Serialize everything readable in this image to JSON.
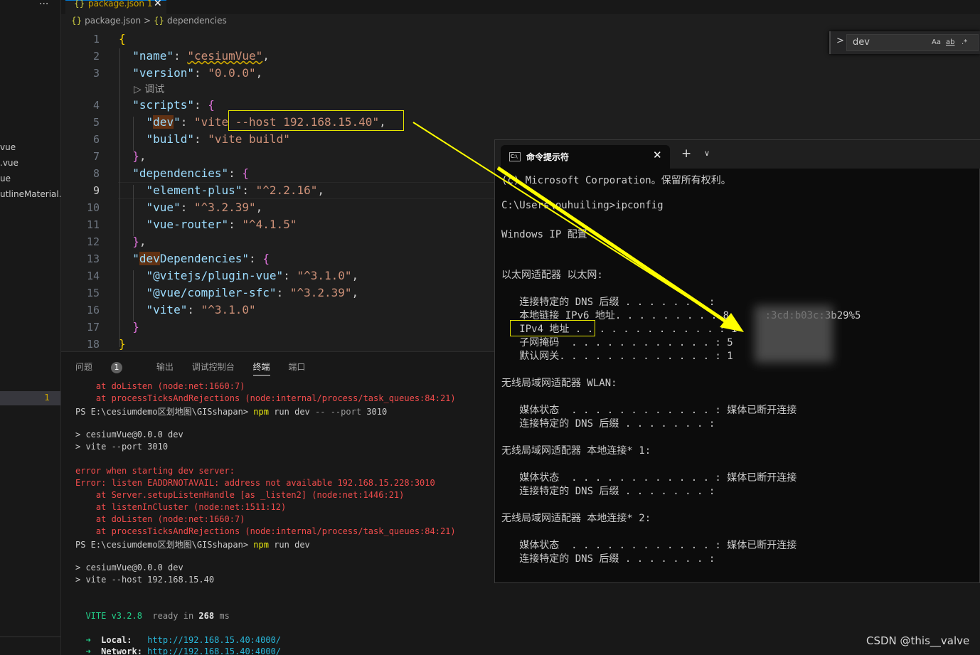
{
  "sidebar": {
    "more": "···",
    "files": [
      "vue",
      ".vue",
      "ue",
      "utlineMaterial..."
    ],
    "active_badge": "1"
  },
  "editor": {
    "tab": {
      "icon": "{}",
      "name": "package.json 1"
    },
    "breadcrumb": {
      "file": "package.json",
      "sep": ">",
      "node_icon": "{}",
      "node": "dependencies"
    },
    "line_numbers": [
      "1",
      "2",
      "3",
      "4",
      "5",
      "6",
      "7",
      "8",
      "9",
      "10",
      "11",
      "12",
      "13",
      "14",
      "15",
      "16",
      "17",
      "18"
    ],
    "codelens": "▷ 调试",
    "lines": {
      "l1": "{",
      "l2": [
        "\"name\"",
        ": ",
        "\"cesiumVue\"",
        ","
      ],
      "l3": [
        "\"version\"",
        ": ",
        "\"0.0.0\"",
        ","
      ],
      "l4": [
        "\"scripts\"",
        ": ",
        "{"
      ],
      "l5": [
        "\"",
        "dev",
        "\"",
        ": ",
        "\"vite --host 192.168.15.40\"",
        ","
      ],
      "l6": [
        "\"build\"",
        ": ",
        "\"vite build\""
      ],
      "l7": [
        "}",
        ","
      ],
      "l8": [
        "\"dependencies\"",
        ": ",
        "{"
      ],
      "l9": [
        "\"element-plus\"",
        ": ",
        "\"^2.2.16\"",
        ","
      ],
      "l10": [
        "\"vue\"",
        ": ",
        "\"^3.2.39\"",
        ","
      ],
      "l11": [
        "\"vue-router\"",
        ": ",
        "\"^4.1.5\""
      ],
      "l12": [
        "}",
        ","
      ],
      "l13": [
        "\"",
        "dev",
        "Dependencies\"",
        ": ",
        "{"
      ],
      "l14": [
        "\"@vitejs/plugin-vue\"",
        ": ",
        "\"^3.1.0\"",
        ","
      ],
      "l15": [
        "\"@vue/compiler-sfc\"",
        ": ",
        "\"^3.2.39\"",
        ","
      ],
      "l16": [
        "\"vite\"",
        ": ",
        "\"^3.1.0\""
      ],
      "l17": "}",
      "l18": "}"
    }
  },
  "find_widget": {
    "chevron": ">",
    "value": "dev",
    "opt_case": "Aa",
    "opt_word": "ab",
    "opt_regex": ".*"
  },
  "panel": {
    "tabs": {
      "problems": "问题",
      "problems_count": "1",
      "output": "输出",
      "debug": "调试控制台",
      "terminal": "终端",
      "ports": "端口"
    },
    "terminal": {
      "t1": "    at doListen (node:net:1660:7)",
      "t2": "    at processTicksAndRejections (node:internal/process/task_queues:84:21)",
      "t3_prompt": "PS E:\\cesiumdemo区划地图\\GISshapan> ",
      "t3_npm": "npm",
      "t3_cmd": " run dev ",
      "t3_args": "-- --port",
      "t3_num": " 3010",
      "t4": "> cesiumVue@0.0.0 dev",
      "t5": "> vite --port 3010",
      "t6": "error when starting dev server:",
      "t7": "Error: listen EADDRNOTAVAIL: address not available 192.168.15.228:3010",
      "t8": "    at Server.setupListenHandle [as _listen2] (node:net:1446:21)",
      "t9": "    at listenInCluster (node:net:1511:12)",
      "t10": "    at doListen (node:net:1660:7)",
      "t11": "    at processTicksAndRejections (node:internal/process/task_queues:84:21)",
      "t12_prompt": "PS E:\\cesiumdemo区划地图\\GISshapan> ",
      "t12_npm": "npm",
      "t12_cmd": " run dev",
      "t13": "> cesiumVue@0.0.0 dev",
      "t14": "> vite --host 192.168.15.40",
      "t15_vite": "VITE v3.2.8",
      "t15_ready": "ready in",
      "t15_ms": "268",
      "t15_unit": "ms",
      "t16_arrow": "➜",
      "t16_label": "Local:",
      "t16_url": "http://192.168.15.40:4000/",
      "t17_arrow": "➜",
      "t17_label": "Network:",
      "t17_url": "http://192.168.15.40:4000/"
    }
  },
  "cmd": {
    "title": "命令提示符",
    "icon_text": "C:\\",
    "close": "✕",
    "new_tab": "+",
    "dropdown": "∨",
    "lines": {
      "c1": "(c) Microsoft Corporation。保留所有权利。",
      "c2": "C:\\Users\\ouhuiling>ipconfig",
      "c3": "Windows IP 配置",
      "c4": "以太网适配器 以太网:",
      "c5": "   连接特定的 DNS 后缀 . . . . . . . :",
      "c6": "   本地链接 IPv6 地址. . . . . . . . : 8      :3cd:b03c:3b29%5",
      "c7": "   IPv4 地址 . . . . . . . . . . . . : 1",
      "c8": "   子网掩码  . . . . . . . . . . . . : 5",
      "c9": "   默认网关. . . . . . . . . . . . . : 1",
      "c10": "无线局域网适配器 WLAN:",
      "c11": "   媒体状态  . . . . . . . . . . . . : 媒体已断开连接",
      "c12": "   连接特定的 DNS 后缀 . . . . . . . :",
      "c13": "无线局域网适配器 本地连接* 1:",
      "c14": "   媒体状态  . . . . . . . . . . . . : 媒体已断开连接",
      "c15": "   连接特定的 DNS 后缀 . . . . . . . :",
      "c16": "无线局域网适配器 本地连接* 2:",
      "c17": "   媒体状态  . . . . . . . . . . . . : 媒体已断开连接",
      "c18": "   连接特定的 DNS 后缀 . . . . . . . :"
    }
  },
  "colors": {
    "annotation": "#e5e500",
    "arrow": "#ffff00"
  },
  "watermark": "CSDN @this__valve"
}
